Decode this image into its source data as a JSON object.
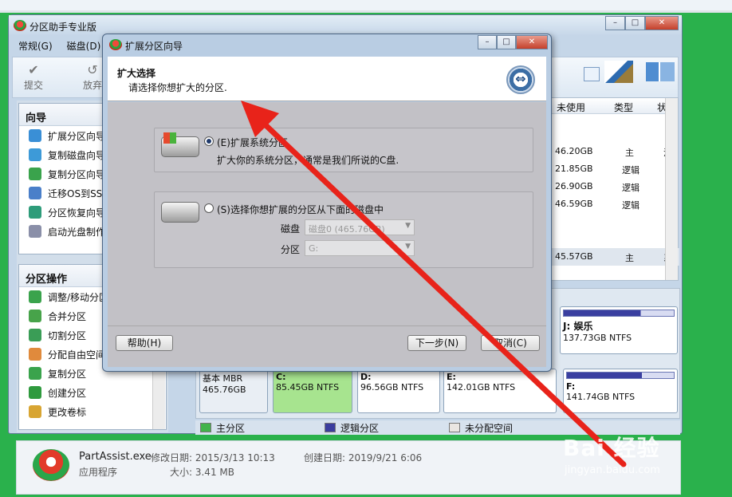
{
  "main_window": {
    "title": "分区助手专业版",
    "menu": [
      "常规(G)",
      "磁盘(D)"
    ],
    "toolbar": {
      "commit": "提交",
      "discard": "放弃"
    },
    "window_buttons": {
      "minimize": "–",
      "maximize": "□",
      "close": "✕"
    }
  },
  "sidebar": {
    "wizard_title": "向导",
    "wizard_items": [
      "扩展分区向导",
      "复制磁盘向导",
      "复制分区向导",
      "迁移OS到SSD",
      "分区恢复向导",
      "启动光盘制作"
    ],
    "ops_title": "分区操作",
    "ops_items": [
      "调整/移动分区",
      "合并分区",
      "切割分区",
      "分配自由空间",
      "复制分区",
      "创建分区",
      "更改卷标"
    ]
  },
  "table": {
    "headers": {
      "free": "未使用",
      "type": "类型",
      "extra": "状"
    },
    "rows": [
      {
        "free": "46.20GB",
        "type": "主",
        "extra": "活"
      },
      {
        "free": "21.85GB",
        "type": "逻辑",
        "extra": ""
      },
      {
        "free": "26.90GB",
        "type": "逻辑",
        "extra": ""
      },
      {
        "free": "46.59GB",
        "type": "逻辑",
        "extra": ""
      },
      {
        "free": "45.57GB",
        "type": "主",
        "extra": "系"
      }
    ]
  },
  "disk_map": {
    "disk0": {
      "label": "基本 MBR",
      "size": "465.76GB"
    },
    "partitions": [
      {
        "name": "C:",
        "size": "85.45GB NTFS"
      },
      {
        "name": "D:",
        "size": "96.56GB NTFS"
      },
      {
        "name": "E:",
        "size": "142.01GB NTFS"
      },
      {
        "name": "F:",
        "size": "141.74GB NTFS"
      }
    ],
    "j": {
      "name": "J: 娱乐",
      "size": "137.73GB NTFS"
    }
  },
  "legend": {
    "primary": "主分区",
    "logical": "逻辑分区",
    "unallocated": "未分配空间"
  },
  "legend_colors": {
    "primary": "#42b34a",
    "logical": "#3b3d9e",
    "unallocated": "#eae6e2"
  },
  "status": {
    "filename": "PartAssist.exe",
    "modified": "修改日期: 2015/3/13 10:13",
    "created": "创建日期: 2019/9/21 6:06",
    "kind": "应用程序",
    "size": "大小: 3.41 MB"
  },
  "dialog": {
    "title": "扩展分区向导",
    "heading": "扩大选择",
    "subheading": "请选择你想扩大的分区.",
    "option1_label": "(E)扩展系统分区",
    "option1_desc": "扩大你的系统分区，通常是我们所说的C盘.",
    "option1_selected": true,
    "option2_label": "(S)选择你想扩展的分区从下面的磁盘中",
    "option2_selected": false,
    "disk_label": "磁盘",
    "disk_value": "磁盘0 (465.76GB)",
    "partition_label": "分区",
    "partition_value": "G:",
    "help_button": "帮助(H)",
    "next_button": "下一步(N)",
    "cancel_button": "取消(C)"
  },
  "watermark": {
    "brand": "Bai 经验",
    "url": "jingyan.baidu.com"
  },
  "annotation_color": "#e8231a"
}
